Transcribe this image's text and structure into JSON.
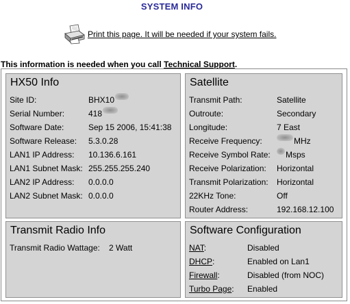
{
  "page": {
    "title": "SYSTEM INFO",
    "print_text": "Print this page. It will be needed if your system fails.",
    "info_prefix": "This information is needed when you call",
    "info_link": "Technical Support",
    "info_suffix": "."
  },
  "hx50": {
    "title": "HX50 Info",
    "rows": [
      {
        "label": "Site ID:",
        "value": "BHX10"
      },
      {
        "label": "Serial Number:",
        "value": "418"
      },
      {
        "label": "Software Date:",
        "value": "Sep 15 2006, 15:41:38"
      },
      {
        "label": "Software Release:",
        "value": "5.3.0.28"
      },
      {
        "label": "LAN1 IP Address:",
        "value": "10.136.6.161"
      },
      {
        "label": "LAN1 Subnet Mask:",
        "value": "255.255.255.240"
      },
      {
        "label": "LAN2 IP Address:",
        "value": "0.0.0.0"
      },
      {
        "label": "LAN2 Subnet Mask:",
        "value": "0.0.0.0"
      }
    ]
  },
  "satellite": {
    "title": "Satellite",
    "rows": [
      {
        "label": "Transmit Path:",
        "value": "Satellite"
      },
      {
        "label": "Outroute:",
        "value": "Secondary"
      },
      {
        "label": "Longitude:",
        "value": "7 East"
      },
      {
        "label": "Receive Frequency:",
        "value": "MHz"
      },
      {
        "label": "Receive Symbol Rate:",
        "value": "Msps"
      },
      {
        "label": "Receive Polarization:",
        "value": "Horizontal"
      },
      {
        "label": "Transmit Polarization:",
        "value": "Horizontal"
      },
      {
        "label": "22KHz Tone:",
        "value": "Off"
      },
      {
        "label": "Router Address:",
        "value": "192.168.12.100"
      }
    ]
  },
  "transmit_radio": {
    "title": "Transmit Radio Info",
    "rows": [
      {
        "label": "Transmit Radio Wattage:",
        "value": "2 Watt"
      }
    ]
  },
  "software_config": {
    "title": "Software Configuration",
    "rows": [
      {
        "label": "NAT",
        "suffix": ":",
        "value": "Disabled"
      },
      {
        "label": "DHCP",
        "suffix": ":",
        "value": "Enabled on Lan1"
      },
      {
        "label": "Firewall",
        "suffix": ":",
        "value": "Disabled (from NOC)"
      },
      {
        "label": "Turbo Page",
        "suffix": ":",
        "value": "Enabled"
      }
    ]
  },
  "colors": {
    "title_blue": "#2a2a9a",
    "panel_gray": "#d4d4d4",
    "panel_border": "#909090"
  },
  "icons": {
    "print": "printer-icon"
  }
}
